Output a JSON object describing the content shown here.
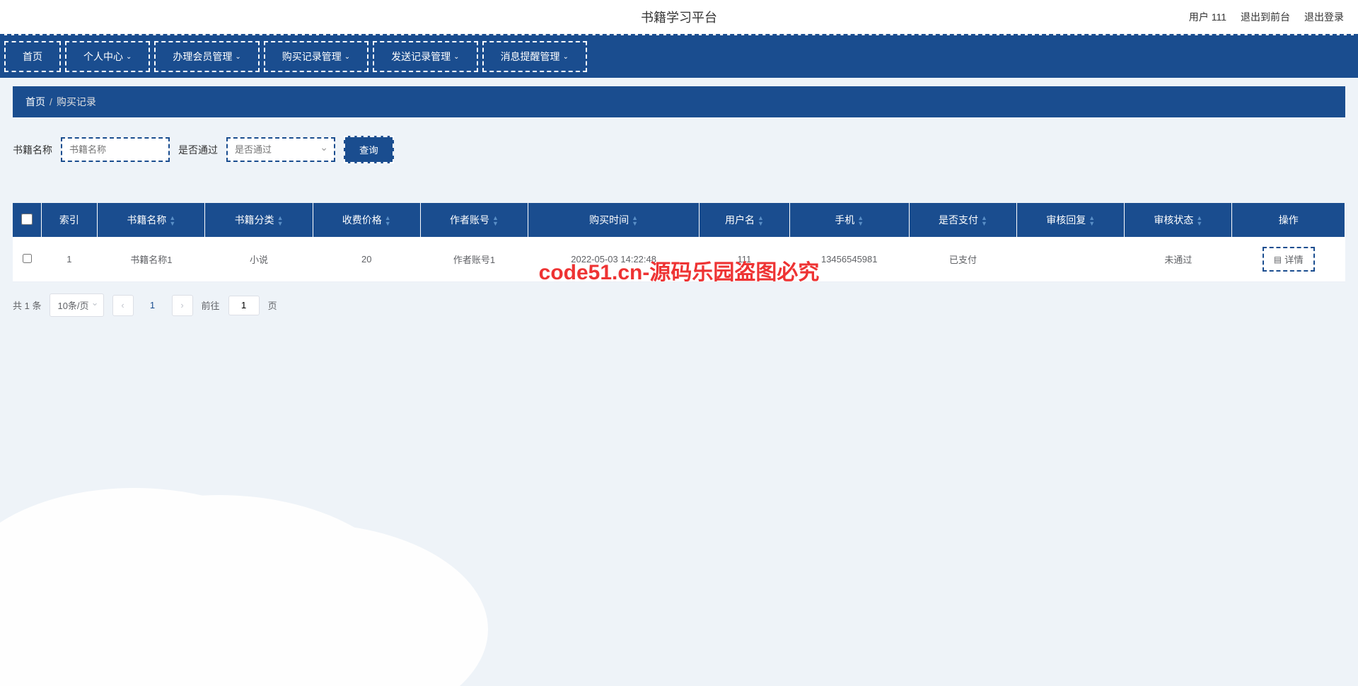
{
  "header": {
    "title": "书籍学习平台",
    "user_label": "用户 111",
    "goto_front": "退出到前台",
    "logout": "退出登录"
  },
  "nav": [
    {
      "label": "首页",
      "has_sub": false
    },
    {
      "label": "个人中心",
      "has_sub": true
    },
    {
      "label": "办理会员管理",
      "has_sub": true
    },
    {
      "label": "购买记录管理",
      "has_sub": true
    },
    {
      "label": "发送记录管理",
      "has_sub": true
    },
    {
      "label": "消息提醒管理",
      "has_sub": true
    }
  ],
  "breadcrumb": {
    "root": "首页",
    "current": "购买记录"
  },
  "filter": {
    "book_name_label": "书籍名称",
    "book_name_placeholder": "书籍名称",
    "pass_label": "是否通过",
    "pass_placeholder": "是否通过",
    "query_btn": "查询"
  },
  "table": {
    "headers": [
      "索引",
      "书籍名称",
      "书籍分类",
      "收费价格",
      "作者账号",
      "购买时间",
      "用户名",
      "手机",
      "是否支付",
      "审核回复",
      "审核状态",
      "操作"
    ],
    "rows": [
      {
        "index": "1",
        "book_name": "书籍名称1",
        "category": "小说",
        "price": "20",
        "author": "作者账号1",
        "buy_time": "2022-05-03 14:22:48",
        "username": "111",
        "phone": "13456545981",
        "paid": "已支付",
        "review_reply": "",
        "review_status": "未通过"
      }
    ],
    "detail_btn": "详情"
  },
  "pagination": {
    "total_text": "共 1 条",
    "page_size": "10条/页",
    "current": "1",
    "goto_prefix": "前往",
    "goto_value": "1",
    "goto_suffix": "页"
  },
  "watermark": "code51.cn-源码乐园盗图必究"
}
